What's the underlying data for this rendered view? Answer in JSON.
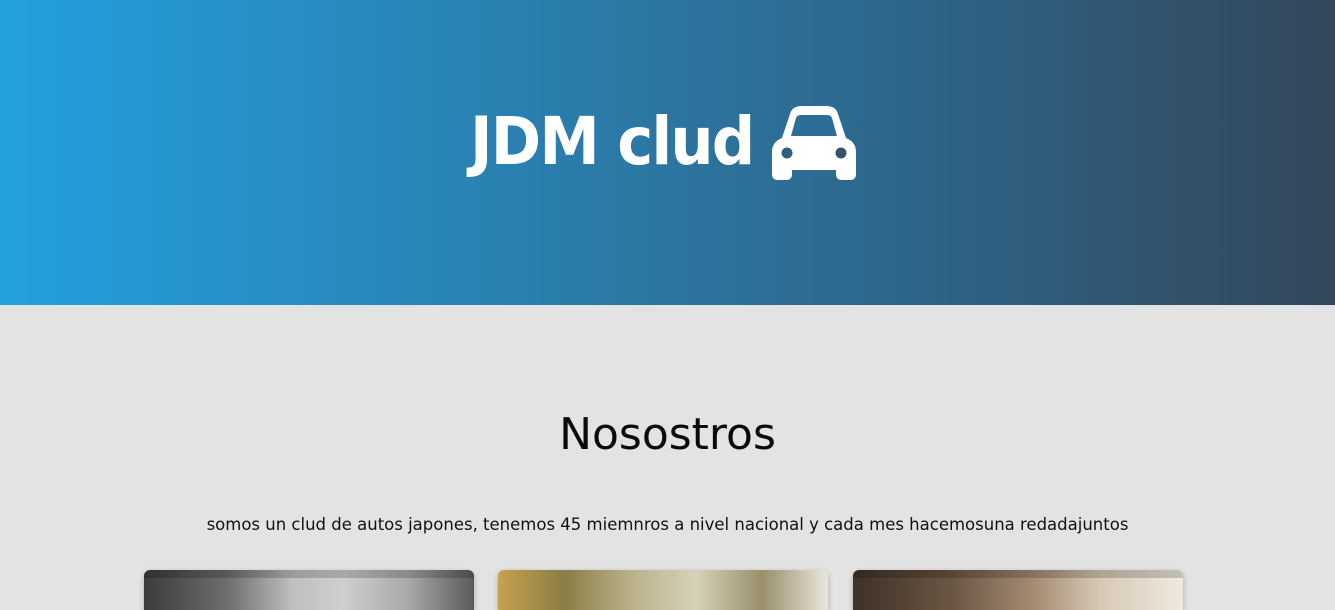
{
  "hero": {
    "brand": "JDM clud",
    "icon": "car-icon",
    "gradient": [
      "#24a0de",
      "#34475a"
    ]
  },
  "about": {
    "title": "Nosostros",
    "description": "somos un clud de autos japones, tenemos 45 miemnros a nivel nacional y cada mes hacemosuna redadajuntos"
  },
  "gallery": {
    "cards": [
      {
        "name": "gallery-image-1"
      },
      {
        "name": "gallery-image-2"
      },
      {
        "name": "gallery-image-3"
      }
    ]
  }
}
